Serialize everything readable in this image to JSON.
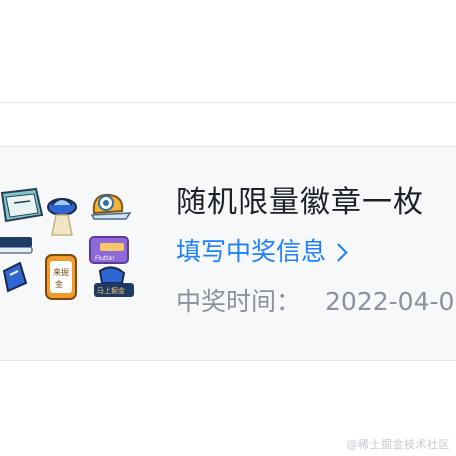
{
  "prize": {
    "title": "随机限量徽章一枚",
    "link_label": "填写中奖信息",
    "time_label": "中奖时间：",
    "time_value": "2022-04-0",
    "badge_texts": [
      "来掘金",
      "Flutter",
      "马上掘金"
    ]
  },
  "watermark": "@稀土掘金技术社区",
  "colors": {
    "link": "#1e80ff",
    "title": "#1d2129",
    "muted": "#8a919f",
    "card_bg": "#f7f8fa"
  }
}
